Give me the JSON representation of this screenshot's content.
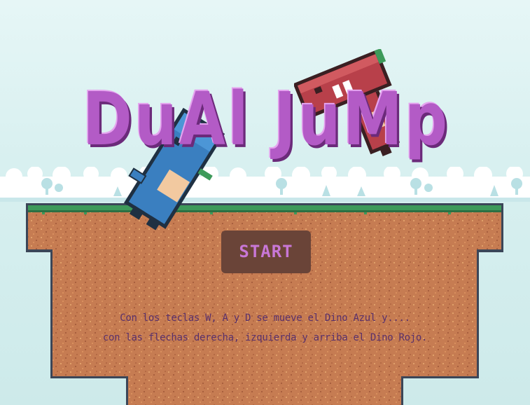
{
  "game": {
    "title": "DuAl JuMp",
    "start_label": "START",
    "instructions": [
      "Con los teclas W, A y D se mueve el Dino Azul y....",
      "con las flechas derecha, izquierda y arriba el Dino Rojo."
    ]
  },
  "characters": {
    "blue": "Dino Azul",
    "red": "Dino Rojo"
  },
  "colors": {
    "title": "#b35bc6",
    "button_bg": "#6a4438",
    "button_text": "#c877d6",
    "dirt": "#c47a52",
    "grass": "#3d9a5a",
    "sky": "#dff3f3",
    "blue_dino": "#3a7fc0",
    "red_dino": "#b8404a"
  }
}
